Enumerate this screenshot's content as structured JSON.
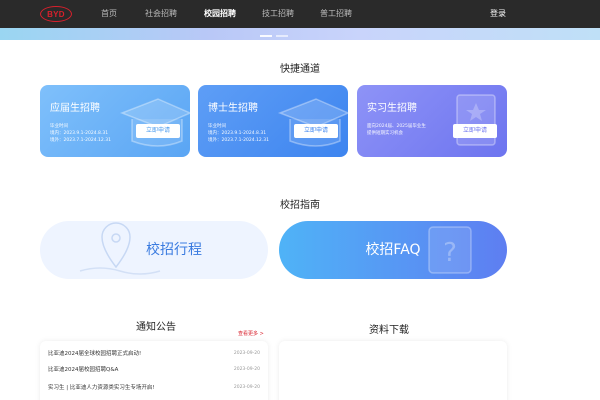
{
  "header": {
    "logo_text": "BYD",
    "nav": [
      {
        "label": "首页"
      },
      {
        "label": "社会招聘"
      },
      {
        "label": "校园招聘"
      },
      {
        "label": "技工招聘"
      },
      {
        "label": "普工招聘"
      }
    ],
    "active_index": 2,
    "login_label": "登录"
  },
  "quick": {
    "title": "快捷通道",
    "cards": [
      {
        "title": "应届生招聘",
        "desc": [
          "毕业时间",
          "境内：2023.9.1-2024.8.31",
          "境外：2023.7.1-2024.12.31"
        ],
        "button": "立即申请",
        "color_from": "#7fc0fb",
        "color_to": "#5aa5f4",
        "accent": "#4b9bee"
      },
      {
        "title": "博士生招聘",
        "desc": [
          "毕业时间",
          "境内：2023.9.1-2024.8.31",
          "境外：2023.7.1-2024.12.31"
        ],
        "button": "立即申请",
        "color_from": "#5e9ef6",
        "color_to": "#3d84ef",
        "accent": "#3d84ef"
      },
      {
        "title": "实习生招聘",
        "desc": [
          "面向2024届、2025届毕业生",
          "提供短期实习机会"
        ],
        "button": "立即申请",
        "color_from": "#8e93f7",
        "color_to": "#6d74ef",
        "accent": "#6d74ef"
      }
    ]
  },
  "guide": {
    "title": "校招指南",
    "cards": [
      {
        "label": "校招行程"
      },
      {
        "label": "校招FAQ"
      }
    ]
  },
  "notice": {
    "title": "通知公告",
    "more": "查看更多 >",
    "items": [
      {
        "text": "比亚迪2024届全球校园招聘正式启动!",
        "date": "2023-09-20"
      },
      {
        "text": "比亚迪2024届校园招聘Q&A",
        "date": "2023-09-20"
      },
      {
        "text": "实习生 | 比亚迪人力资源类实习生专场开启!",
        "date": "2023-09-20"
      }
    ]
  },
  "downloads": {
    "title": "资料下载"
  }
}
